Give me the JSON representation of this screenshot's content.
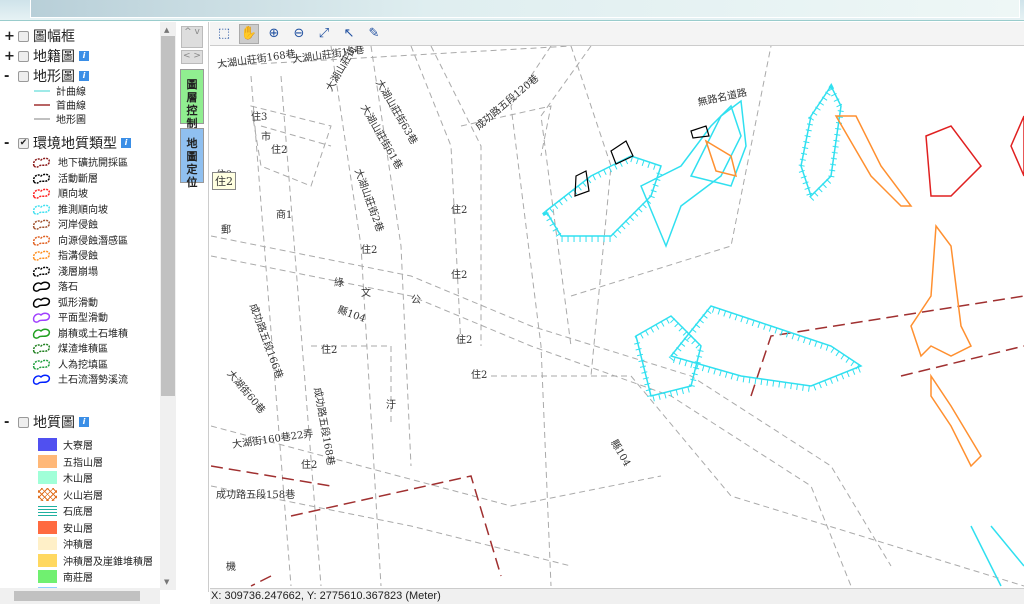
{
  "panel": {
    "groups": [
      {
        "toggle": "+",
        "label": "圖幅框",
        "checked": false,
        "info": false
      },
      {
        "toggle": "+",
        "label": "地籍圖",
        "checked": false,
        "info": true
      },
      {
        "toggle": "-",
        "label": "地形圖",
        "checked": false,
        "info": true
      },
      {
        "toggle": "-",
        "label": "環境地質類型",
        "checked": true,
        "info": true
      },
      {
        "toggle": "-",
        "label": "地質圖",
        "checked": false,
        "info": true
      }
    ],
    "info_glyph": "i",
    "check_glyph": "✔",
    "terrain_legend": [
      {
        "label": "計曲線",
        "color": "#7fe3e0"
      },
      {
        "label": "首曲線",
        "color": "#a03030"
      },
      {
        "label": "地形圖",
        "color": "#aaaaaa"
      }
    ],
    "env_legend": [
      {
        "label": "地下礦抗開採區",
        "color": "#8b1a1a"
      },
      {
        "label": "活動斷層",
        "color": "#000000"
      },
      {
        "label": "順向坡",
        "color": "#ff2020"
      },
      {
        "label": "推測順向坡",
        "color": "#40e0f0"
      },
      {
        "label": "河岸侵蝕",
        "color": "#a0522d"
      },
      {
        "label": "向源侵蝕潛感區",
        "color": "#e06020"
      },
      {
        "label": "指溝侵蝕",
        "color": "#ff9020"
      },
      {
        "label": "淺層崩塌",
        "color": "#000000"
      },
      {
        "label": "落石",
        "color": "#000000"
      },
      {
        "label": "弧形滑動",
        "color": "#000000"
      },
      {
        "label": "平面型滑動",
        "color": "#a040ff"
      },
      {
        "label": "崩積或土石堆積",
        "color": "#20a020"
      },
      {
        "label": "煤渣堆積區",
        "color": "#208020"
      },
      {
        "label": "人為挖填區",
        "color": "#20a040"
      },
      {
        "label": "土石流潛勢溪流",
        "color": "#0020ff"
      }
    ],
    "geo_legend": [
      {
        "label": "大寮層",
        "color": "#5050f0"
      },
      {
        "label": "五指山層",
        "color": "#ffb878"
      },
      {
        "label": "木山層",
        "color": "#a0ffd8"
      },
      {
        "label": "火山岩層",
        "color": "#e07020"
      },
      {
        "label": "石底層",
        "color": "#20b0a0"
      },
      {
        "label": "安山層",
        "color": "#ff6a40"
      },
      {
        "label": "沖積層",
        "color": "#fff0c8"
      },
      {
        "label": "沖積層及崖錐堆積層",
        "color": "#ffd860"
      },
      {
        "label": "南莊層",
        "color": "#70f070"
      },
      {
        "label": "南港層",
        "color": "#90d0ff"
      }
    ]
  },
  "side": {
    "up_down": "^ v",
    "left_right": "< >",
    "layer_tab": "圖層控制",
    "locate_tab": "地圖定位",
    "layer_tab_color": "#90ee90",
    "locate_tab_color": "#90c0f0"
  },
  "toolbar": [
    "zoom-box-icon",
    "pan-icon",
    "zoom-in-icon",
    "zoom-out-icon",
    "full-extent-icon",
    "select-icon",
    "measure-icon"
  ],
  "map": {
    "labels": [
      "大湖山莊街168巷",
      "大湖山莊街15巷",
      "大湖山莊街120巷",
      "大湖山莊街63巷",
      "大湖山莊街61巷",
      "成功路五段120巷",
      "大湖山莊街2巷",
      "無路名道路",
      "住2",
      "住3",
      "市",
      "商1",
      "郵",
      "綠",
      "文",
      "公",
      "縣104",
      "成功路五段166巷",
      "大湖街60巷",
      "成功路五段168巷",
      "大湖街160巷22弄",
      "成功路五段158巷",
      "汙",
      "縣104",
      "機"
    ],
    "hover_label": "住2"
  },
  "status": "X: 309736.247662, Y: 2775610.367823 (Meter)"
}
